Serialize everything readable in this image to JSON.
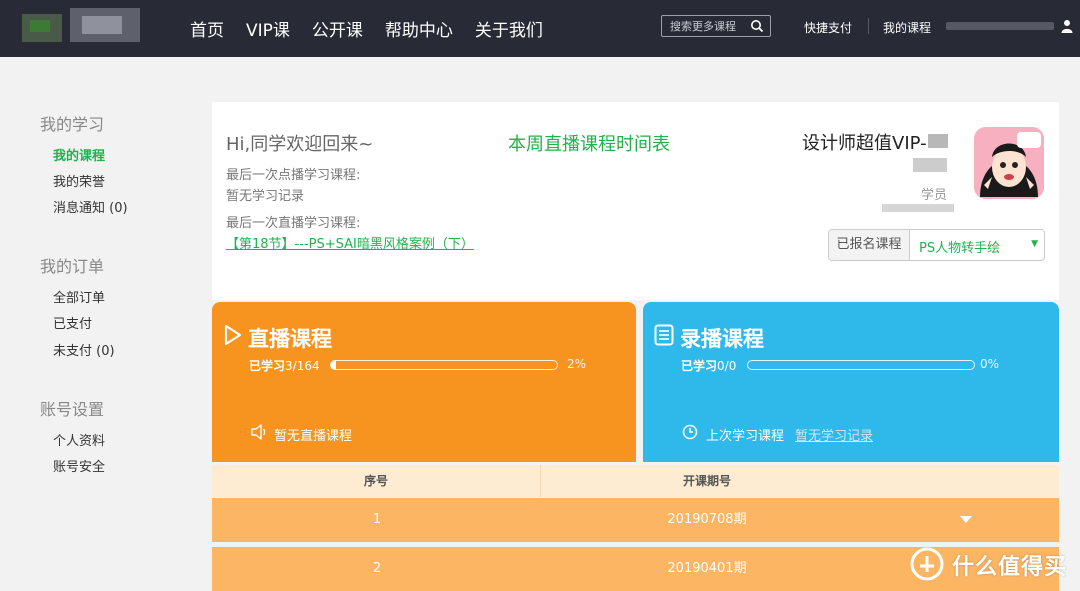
{
  "header": {
    "nav": [
      "首页",
      "VIP课",
      "公开课",
      "帮助中心",
      "关于我们"
    ],
    "search_placeholder": "搜索更多课程",
    "quick_pay": "快捷支付",
    "my_courses": "我的课程"
  },
  "sidebar": {
    "sections": [
      {
        "title": "我的学习",
        "items": [
          "我的课程",
          "我的荣誉",
          "消息通知 (0)"
        ]
      },
      {
        "title": "我的订单",
        "items": [
          "全部订单",
          "已支付",
          "未支付 (0)"
        ]
      },
      {
        "title": "账号设置",
        "items": [
          "个人资料",
          "账号安全"
        ]
      }
    ],
    "active_item": "我的课程"
  },
  "welcome": {
    "greeting": "Hi,同学欢迎回来~",
    "last_vod_label": "最后一次点播学习课程:",
    "last_vod_value": "暂无学习记录",
    "last_live_label": "最后一次直播学习课程:",
    "last_live_link": "【第18节】---PS+SAI暗黑风格案例（下）",
    "schedule_link": "本周直播课程时间表"
  },
  "profile": {
    "vip_title": "设计师超值VIP-",
    "role": "学员",
    "enrolled_label": "已报名课程",
    "enrolled_value": "PS人物转手绘"
  },
  "cards": {
    "live": {
      "title": "直播课程",
      "progress_label": "已学习",
      "progress_count": "3/164",
      "percent_text": "2%",
      "progress": 0.02,
      "footer": "暂无直播课程",
      "color": "#f7941f"
    },
    "recorded": {
      "title": "录播课程",
      "progress_label": "已学习",
      "progress_count": "0/0",
      "percent_text": "0%",
      "progress": 0,
      "footer_label": "上次学习课程",
      "footer_value": "暂无学习记录",
      "color": "#2fb9eb"
    }
  },
  "table": {
    "headers": [
      "序号",
      "开课期号"
    ],
    "rows": [
      {
        "index": "1",
        "term": "20190708期"
      },
      {
        "index": "2",
        "term": "20190401期"
      }
    ]
  },
  "watermark": {
    "text": "什么值得买"
  },
  "colors": {
    "accent": "#22b14c",
    "header_bg": "#282b36",
    "row_bg": "#fbb563"
  }
}
